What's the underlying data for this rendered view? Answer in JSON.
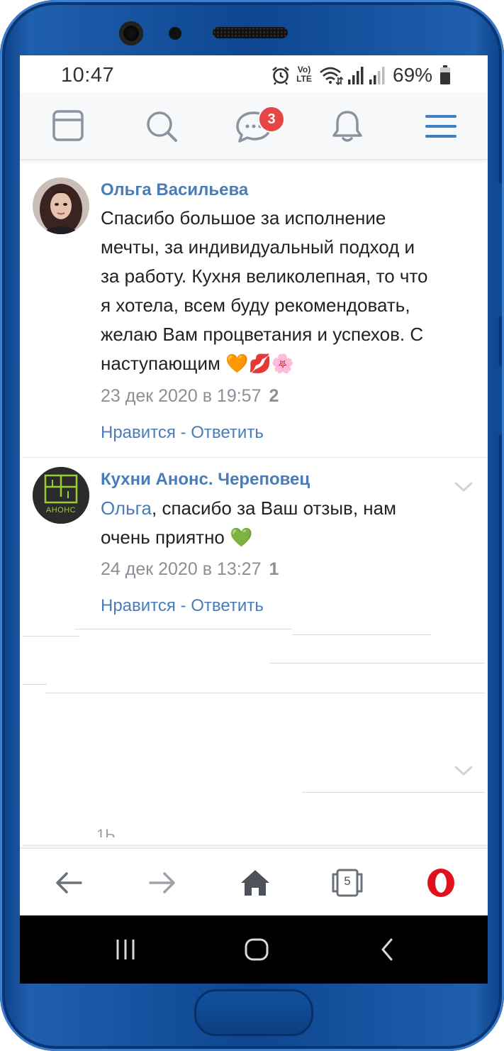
{
  "status_bar": {
    "time": "10:47",
    "network_label_top": "Vo)",
    "network_label_bottom": "LTE",
    "battery_percent": "69%",
    "icons": [
      "alarm-icon",
      "volte-icon",
      "wifi-icon",
      "signal-icon",
      "signal-icon",
      "battery-icon"
    ]
  },
  "top_nav": {
    "items": [
      {
        "icon": "feed-icon"
      },
      {
        "icon": "search-icon"
      },
      {
        "icon": "messages-icon",
        "badge": "3"
      },
      {
        "icon": "notifications-icon"
      },
      {
        "icon": "menu-icon"
      }
    ],
    "accent_color": "#4a7cb8",
    "badge_color": "#e64646"
  },
  "comments": [
    {
      "author": "Ольга Васильева",
      "lines": [
        "Спасибо большое за исполнение",
        "мечты, за индивидуальный подход и",
        "за работу. Кухня великолепная, то что",
        "я хотела, всем буду рекомендовать,",
        "желаю Вам процветания и успехов. С",
        "наступающим"
      ],
      "emoji": [
        "🧡",
        "💋",
        "🌸"
      ],
      "date": "23 дек 2020 в 19:57",
      "likes": "2",
      "like_label": "Нравится",
      "separator": " - ",
      "reply_label": "Ответить"
    },
    {
      "author": "Кухни Анонс. Череповец",
      "avatar_logo_text": "АНОНС",
      "mention": "Ольга",
      "lines": [
        ", спасибо за Ваш отзыв, нам",
        "очень приятно"
      ],
      "emoji": [
        "💚"
      ],
      "date": "24 дек 2020 в 13:27",
      "likes": "1",
      "like_label": "Нравится",
      "separator": " - ",
      "reply_label": "Ответить"
    }
  ],
  "partial_text": "1Ь",
  "bottom_bar": {
    "items": [
      {
        "icon": "back-arrow-icon"
      },
      {
        "icon": "forward-arrow-icon"
      },
      {
        "icon": "home-icon"
      },
      {
        "icon": "tabs-icon",
        "count": "5"
      },
      {
        "icon": "opera-icon"
      }
    ]
  },
  "android_nav": {
    "items": [
      "recents-icon",
      "home-circle-icon",
      "back-chevron-icon"
    ]
  }
}
